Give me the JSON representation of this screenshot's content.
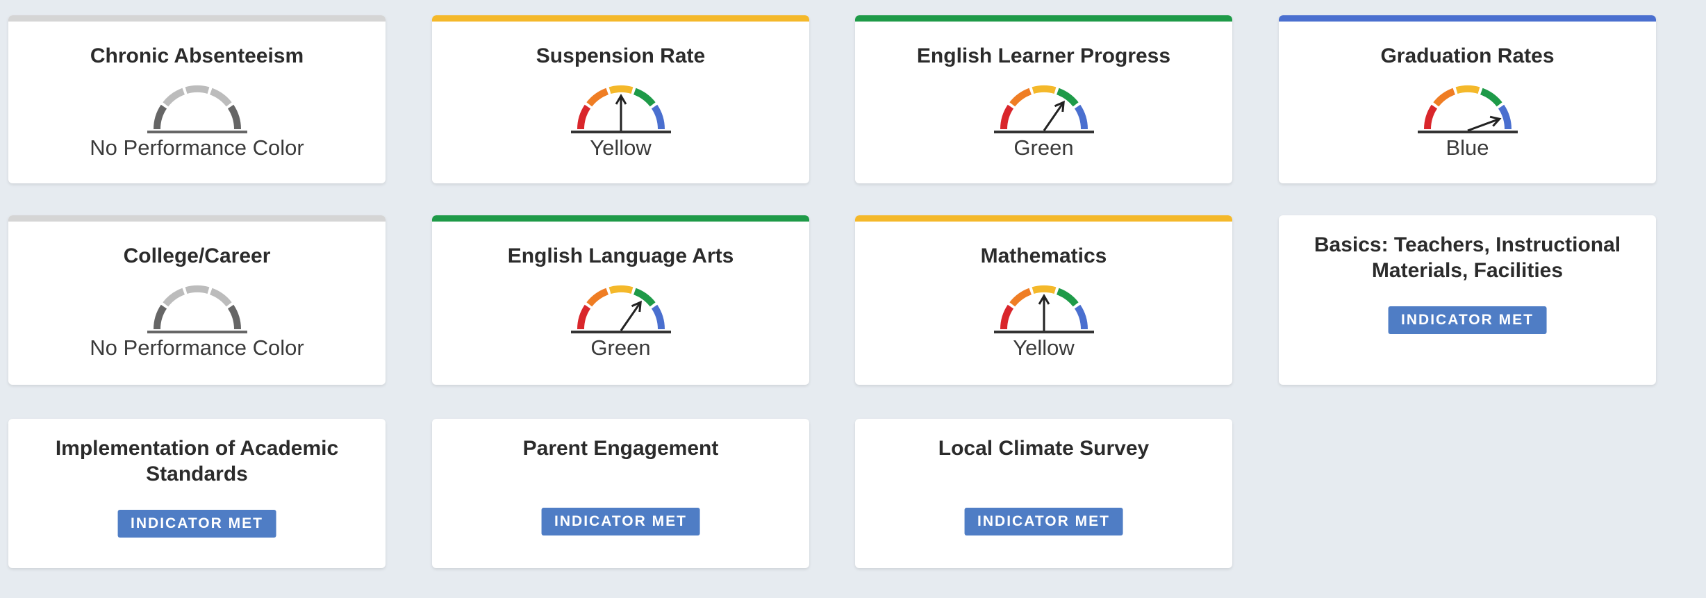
{
  "colors": {
    "red": "#d9262b",
    "orange": "#ef7d24",
    "yellow": "#f4b82a",
    "green": "#1e9a48",
    "blue": "#4a6fcf",
    "gray_dark": "#666666",
    "gray_light": "#bcbcbc",
    "badge": "#4f7dc5",
    "none_bar": "#d5d5d5"
  },
  "cards": [
    {
      "title": "Chronic Absenteeism",
      "status": "No Performance Color",
      "level": "none"
    },
    {
      "title": "Suspension Rate",
      "status": "Yellow",
      "level": "yellow"
    },
    {
      "title": "English Learner Progress",
      "status": "Green",
      "level": "green"
    },
    {
      "title": "Graduation Rates",
      "status": "Blue",
      "level": "blue"
    },
    {
      "title": "College/Career",
      "status": "No Performance Color",
      "level": "none"
    },
    {
      "title": "English Language Arts",
      "status": "Green",
      "level": "green"
    },
    {
      "title": "Mathematics",
      "status": "Yellow",
      "level": "yellow"
    },
    {
      "title_lines": [
        "Basics: Teachers, Instructional",
        "Materials, Facilities"
      ],
      "badge": "INDICATOR MET"
    },
    {
      "title_lines": [
        "Implementation of Academic",
        "Standards"
      ],
      "badge": "INDICATOR MET"
    },
    {
      "title": "Parent Engagement",
      "badge": "INDICATOR MET"
    },
    {
      "title": "Local Climate Survey",
      "badge": "INDICATOR MET"
    }
  ]
}
